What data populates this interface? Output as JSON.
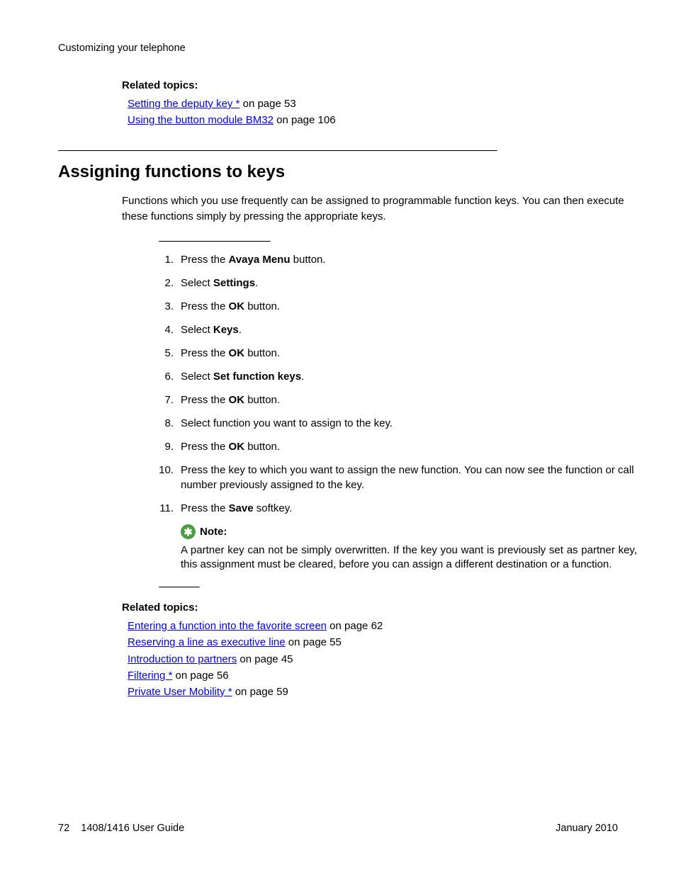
{
  "header": "Customizing your telephone",
  "related1": {
    "heading": "Related topics:",
    "items": [
      {
        "link": "Setting the deputy key *",
        "suffix": " on page 53"
      },
      {
        "link": "Using the button module BM32",
        "suffix": " on page 106"
      }
    ]
  },
  "section_title": "Assigning functions to keys",
  "intro": "Functions which you use frequently can be assigned to programmable function keys. You can then execute these functions simply by pressing the appropriate keys.",
  "steps": [
    {
      "n": "1.",
      "pre": "Press the ",
      "bold": "Avaya Menu",
      "post": " button."
    },
    {
      "n": "2.",
      "pre": "Select ",
      "bold": "Settings",
      "post": "."
    },
    {
      "n": "3.",
      "pre": "Press the ",
      "bold": "OK",
      "post": " button."
    },
    {
      "n": "4.",
      "pre": "Select ",
      "bold": "Keys",
      "post": "."
    },
    {
      "n": "5.",
      "pre": "Press the ",
      "bold": "OK",
      "post": " button."
    },
    {
      "n": "6.",
      "pre": "Select ",
      "bold": "Set function keys",
      "post": "."
    },
    {
      "n": "7.",
      "pre": "Press the ",
      "bold": "OK",
      "post": " button."
    },
    {
      "n": "8.",
      "pre": "Select function you want to assign to the key.",
      "bold": "",
      "post": ""
    },
    {
      "n": "9.",
      "pre": "Press the ",
      "bold": "OK",
      "post": " button."
    },
    {
      "n": "10.",
      "pre": "Press the key to which you want to assign the new function. You can now see the function or call number previously assigned to the key.",
      "bold": "",
      "post": ""
    },
    {
      "n": "11.",
      "pre": "Press the ",
      "bold": "Save",
      "post": " softkey."
    }
  ],
  "note": {
    "label": "Note:",
    "text": "A partner key can not be simply overwritten. If the key you want is previously set as partner key, this assignment must be cleared, before you can assign a different destination or a function."
  },
  "related2": {
    "heading": "Related topics:",
    "items": [
      {
        "link": "Entering a function into the favorite screen",
        "suffix": " on page 62"
      },
      {
        "link": "Reserving a line as executive line",
        "suffix": " on page 55"
      },
      {
        "link": "Introduction to partners",
        "suffix": " on page 45"
      },
      {
        "link": "Filtering *",
        "suffix": " on page 56"
      },
      {
        "link": "Private User Mobility *",
        "suffix": " on page 59"
      }
    ]
  },
  "footer": {
    "page": "72",
    "title": "1408/1416 User Guide",
    "date": "January 2010"
  }
}
